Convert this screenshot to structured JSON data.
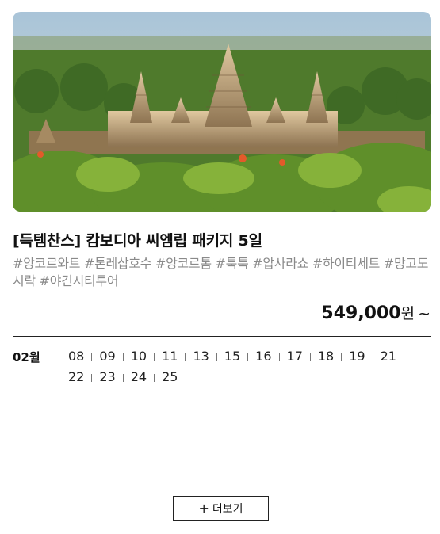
{
  "product": {
    "title": "[득템찬스] 캄보디아 씨엠립 패키지 5일",
    "tags": "#앙코르와트 #톤레삽호수 #앙코르톰 #툭툭 #압사라쇼 #하이티세트 #망고도시락 #야긴시티투어",
    "price": "549,000",
    "price_unit": "원",
    "price_suffix": "~",
    "image_icon": "temple-photo"
  },
  "schedule": {
    "month": "02월",
    "dates": [
      "08",
      "09",
      "10",
      "11",
      "13",
      "15",
      "16",
      "17",
      "18",
      "19",
      "21",
      "22",
      "23",
      "24",
      "25"
    ]
  },
  "more_button": {
    "icon": "plus-icon",
    "label": "더보기"
  }
}
